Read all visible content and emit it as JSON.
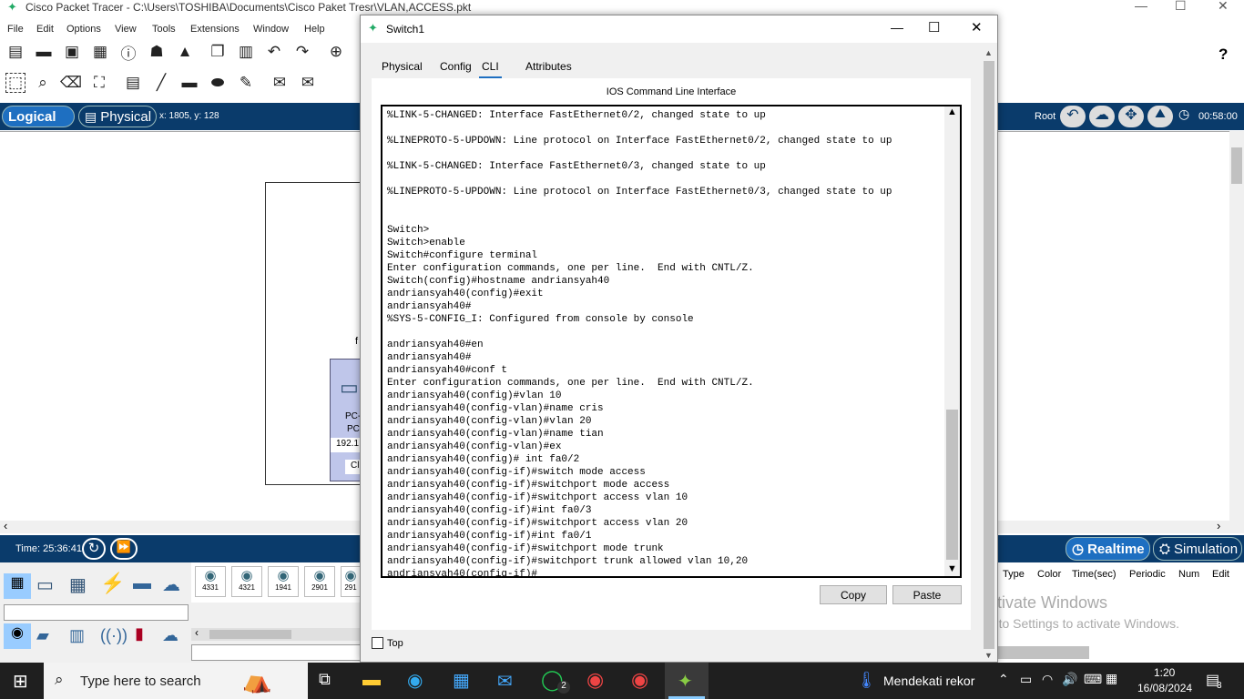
{
  "app": {
    "title": "Cisco Packet Tracer - C:\\Users\\TOSHIBA\\Documents\\Cisco Paket Tresr\\VLAN,ACCESS.pkt",
    "menu": [
      "File",
      "Edit",
      "Options",
      "View",
      "Tools",
      "Extensions",
      "Window",
      "Help"
    ],
    "logical_label": "Logical",
    "physical_label": "Physical",
    "coords": "x: 1805, y: 128",
    "root_label": "Root",
    "clock": "00:58:00",
    "time_label": "Time: 25:36:41",
    "realtime_label": "Realtime",
    "simulation_label": "Simulation",
    "device_models": [
      "4331",
      "4321",
      "1941",
      "2901",
      "291"
    ],
    "event_columns": [
      "Type",
      "Color",
      "Time(sec)",
      "Periodic",
      "Num",
      "Edit"
    ],
    "watermark_line1": "Activate Windows",
    "watermark_line2": "Go to Settings to activate Windows.",
    "canvas_pc": {
      "line1": "PC-",
      "line2": "PC",
      "line3": "192.1",
      "line4": "Cl",
      "label_f": "f"
    }
  },
  "dialog": {
    "title": "Switch1",
    "tabs": [
      "Physical",
      "Config",
      "CLI",
      "Attributes"
    ],
    "active_tab": "CLI",
    "heading": "IOS Command Line Interface",
    "terminal": "%LINK-5-CHANGED: Interface FastEthernet0/2, changed state to up\n\n%LINEPROTO-5-UPDOWN: Line protocol on Interface FastEthernet0/2, changed state to up\n\n%LINK-5-CHANGED: Interface FastEthernet0/3, changed state to up\n\n%LINEPROTO-5-UPDOWN: Line protocol on Interface FastEthernet0/3, changed state to up\n\n\nSwitch>\nSwitch>enable\nSwitch#configure terminal\nEnter configuration commands, one per line.  End with CNTL/Z.\nSwitch(config)#hostname andriansyah40\nandriansyah40(config)#exit\nandriansyah40#\n%SYS-5-CONFIG_I: Configured from console by console\n\nandriansyah40#en\nandriansyah40#\nandriansyah40#conf t\nEnter configuration commands, one per line.  End with CNTL/Z.\nandriansyah40(config)#vlan 10\nandriansyah40(config-vlan)#name cris\nandriansyah40(config-vlan)#vlan 20\nandriansyah40(config-vlan)#name tian\nandriansyah40(config-vlan)#ex\nandriansyah40(config)# int fa0/2\nandriansyah40(config-if)#switch mode access\nandriansyah40(config-if)#switchport mode access\nandriansyah40(config-if)#switchport access vlan 10\nandriansyah40(config-if)#int fa0/3\nandriansyah40(config-if)#switchport access vlan 20\nandriansyah40(config-if)#int fa0/1\nandriansyah40(config-if)#switchport mode trunk\nandriansyah40(config-if)#switchport trunk allowed vlan 10,20\nandriansyah40(config-if)#",
    "copy_label": "Copy",
    "paste_label": "Paste",
    "top_label": "Top"
  },
  "taskbar": {
    "search_placeholder": "Type here to search",
    "weather": "Mendekati rekor",
    "time": "1:20",
    "date": "16/08/2024",
    "notification_count": "3",
    "whatsapp_badge": "2"
  },
  "colors": {
    "accent": "#0a3b6b",
    "taskbar": "#1f1f1f",
    "realtime": "#1e6fc1"
  }
}
